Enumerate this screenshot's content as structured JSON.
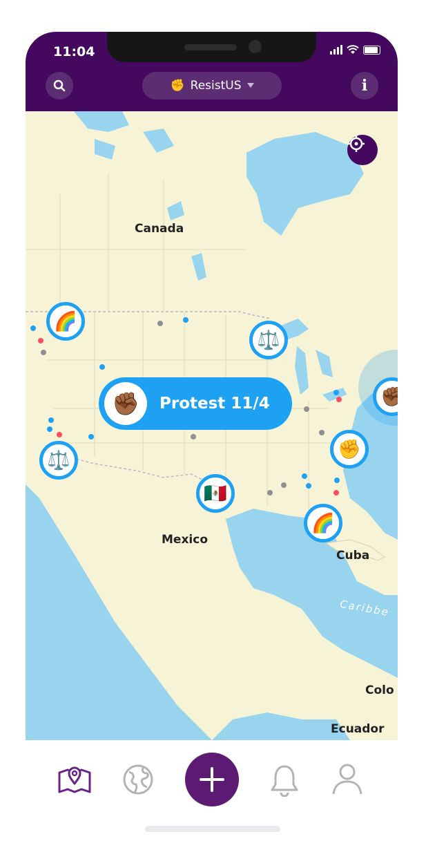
{
  "status_bar": {
    "time": "11:04"
  },
  "header": {
    "search_icon": "search-icon",
    "community_emoji": "✊",
    "community_name": "ResistUS",
    "info_label": "i"
  },
  "map": {
    "labels": {
      "canada": "Canada",
      "mexico": "Mexico",
      "cuba": "Cuba",
      "caribbean": "Caribbe",
      "colombia": "Colo",
      "ecuador": "Ecuador"
    },
    "pins": [
      {
        "emoji": "🌈",
        "name": "rainbow-pin-northwest"
      },
      {
        "emoji": "⚖️",
        "name": "justice-pin-great-lakes"
      },
      {
        "emoji": "⚖️",
        "name": "justice-pin-california"
      },
      {
        "emoji": "🇲🇽",
        "name": "mexico-flag-pin"
      },
      {
        "emoji": "🌈",
        "name": "rainbow-pin-florida"
      },
      {
        "emoji": "✊",
        "name": "fist-pin-east-coast"
      },
      {
        "emoji": "✊🏾",
        "name": "fist-pin-northeast"
      }
    ],
    "protest_callout": {
      "emoji": "✊🏾",
      "label": "Protest 11/4"
    }
  },
  "colors": {
    "brand_purple": "#44095e",
    "accent_blue": "#1ea1f2",
    "dot_red": "#ff4d5e",
    "dot_gray": "#8f8f8f"
  },
  "bottom_nav": {
    "items": [
      "map-icon",
      "globe-icon",
      "add-icon",
      "bell-icon",
      "profile-icon"
    ],
    "active": "map-icon"
  }
}
